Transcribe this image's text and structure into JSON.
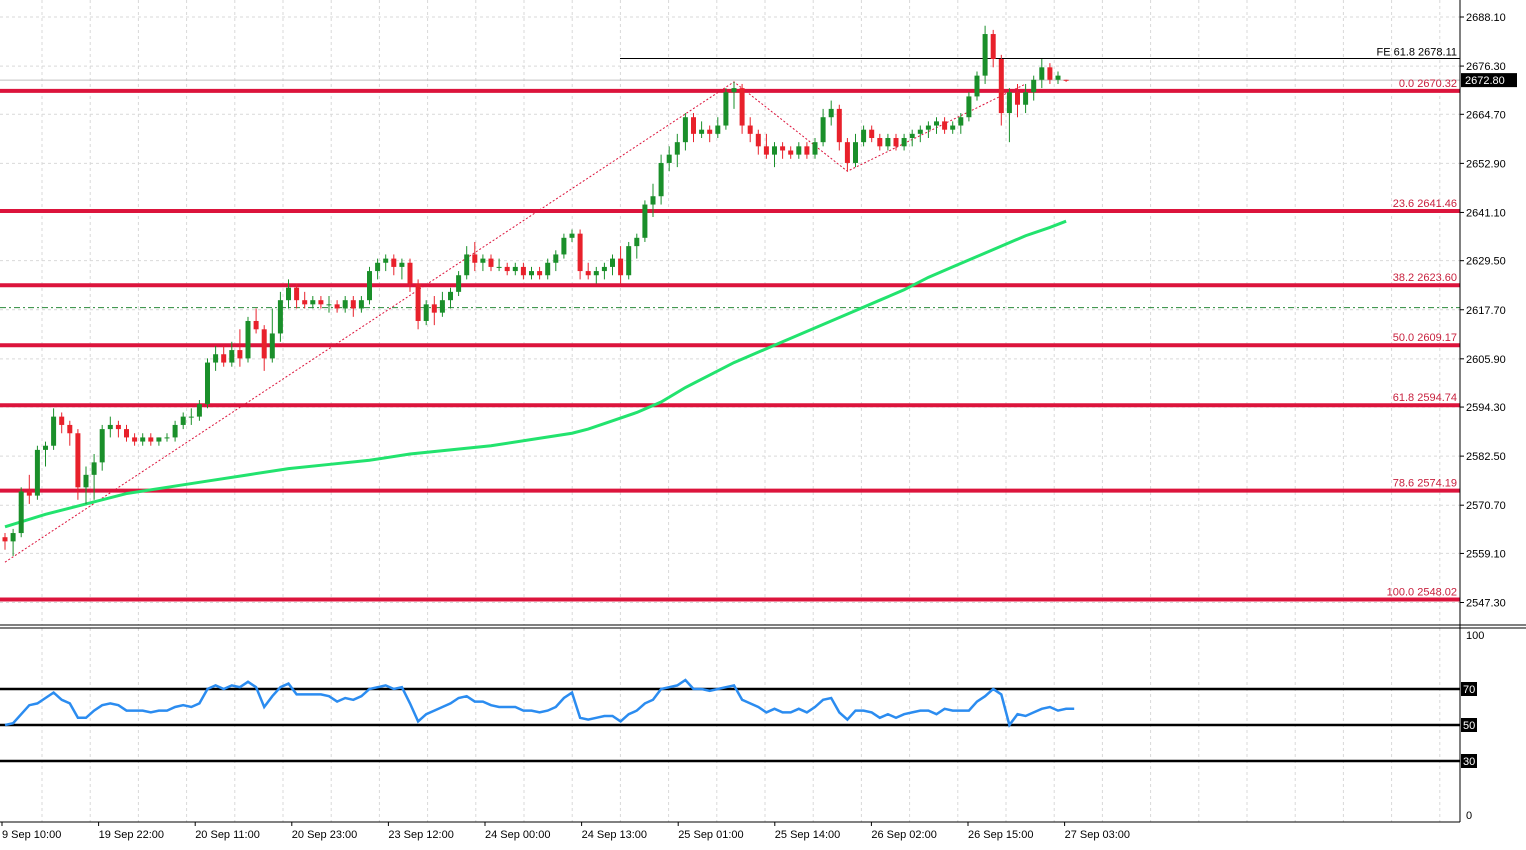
{
  "chart_data": {
    "type": "candlestick",
    "instrument_note": "",
    "colors": {
      "background": "#ffffff",
      "grid": "#d9d9d9",
      "bull": "#1a8f2a",
      "bear": "#e8212b",
      "fib_line": "#dc143c",
      "fib_label": "#c8213e",
      "moving_average": "#22e36e",
      "zigzag": "#dc143c",
      "rsi_line": "#2b8cf0",
      "rsi_levels": "#000000",
      "axis_text": "#000000",
      "price_label_bg": "#000000",
      "price_label_fg": "#ffffff"
    },
    "price_axis": {
      "range": [
        2543.0,
        2693.0
      ],
      "ticks": [
        "2688.10",
        "2676.30",
        "2664.70",
        "2652.90",
        "2641.10",
        "2629.50",
        "2617.70",
        "2605.90",
        "2594.30",
        "2582.50",
        "2570.70",
        "2559.10",
        "2547.30"
      ]
    },
    "current_price": {
      "value": 2672.8,
      "label": "2672.80"
    },
    "x_axis_labels": [
      "9 Sep 10:00",
      "19 Sep 22:00",
      "20 Sep 11:00",
      "20 Sep 23:00",
      "23 Sep 12:00",
      "24 Sep 00:00",
      "24 Sep 13:00",
      "25 Sep 01:00",
      "25 Sep 14:00",
      "26 Sep 02:00",
      "26 Sep 15:00",
      "27 Sep 03:00"
    ],
    "fib_levels": [
      {
        "level": 0.0,
        "price": 2670.32,
        "label": "0.0 2670.32"
      },
      {
        "level": 23.6,
        "price": 2641.46,
        "label": "23.6 2641.46"
      },
      {
        "level": 38.2,
        "price": 2623.6,
        "label": "38.2 2623.60"
      },
      {
        "level": 50.0,
        "price": 2609.17,
        "label": "50.0 2609.17"
      },
      {
        "level": 61.8,
        "price": 2594.74,
        "label": "61.8 2594.74"
      },
      {
        "level": 78.6,
        "price": 2574.19,
        "label": "78.6 2574.19"
      },
      {
        "level": 100.0,
        "price": 2548.02,
        "label": "100.0 2548.02"
      }
    ],
    "fib_extension": {
      "price": 2678.11,
      "label": "FE 61.8 2678.11"
    },
    "horizontal_dashed_price": 2618.2,
    "zigzag_points": [
      {
        "i": 0,
        "price": 2557.0
      },
      {
        "i": 90,
        "price": 2672.5
      },
      {
        "i": 104,
        "price": 2651.0
      },
      {
        "i": 126,
        "price": 2672.0
      }
    ],
    "candles": [
      [
        2563.0,
        2564.0,
        2560.0,
        2562.0
      ],
      [
        2562.0,
        2565.0,
        2558.5,
        2564.0
      ],
      [
        2564.0,
        2575.0,
        2563.0,
        2574.0
      ],
      [
        2574.0,
        2578.0,
        2571.0,
        2573.0
      ],
      [
        2573.0,
        2585.0,
        2572.0,
        2584.0
      ],
      [
        2584.0,
        2586.0,
        2580.0,
        2585.0
      ],
      [
        2585.0,
        2594.0,
        2584.0,
        2592.0
      ],
      [
        2592.0,
        2593.0,
        2588.0,
        2590.0
      ],
      [
        2590.0,
        2591.0,
        2585.0,
        2588.0
      ],
      [
        2588.0,
        2589.0,
        2572.0,
        2575.0
      ],
      [
        2575.0,
        2580.0,
        2571.0,
        2578.0
      ],
      [
        2578.0,
        2583.0,
        2572.0,
        2581.0
      ],
      [
        2581.0,
        2590.0,
        2579.0,
        2589.0
      ],
      [
        2589.0,
        2592.0,
        2587.0,
        2590.0
      ],
      [
        2590.0,
        2591.0,
        2587.0,
        2589.0
      ],
      [
        2589.0,
        2590.0,
        2586.0,
        2587.0
      ],
      [
        2587.0,
        2588.0,
        2585.0,
        2586.0
      ],
      [
        2586.0,
        2588.0,
        2585.0,
        2587.0
      ],
      [
        2587.0,
        2588.0,
        2585.0,
        2586.0
      ],
      [
        2586.0,
        2587.0,
        2585.0,
        2587.0
      ],
      [
        2587.0,
        2588.0,
        2586.0,
        2587.0
      ],
      [
        2587.0,
        2591.0,
        2586.0,
        2590.0
      ],
      [
        2590.0,
        2593.0,
        2589.0,
        2592.0
      ],
      [
        2592.0,
        2594.0,
        2590.0,
        2592.0
      ],
      [
        2592.0,
        2596.0,
        2591.0,
        2595.0
      ],
      [
        2595.0,
        2606.0,
        2594.0,
        2605.0
      ],
      [
        2605.0,
        2609.0,
        2603.0,
        2607.0
      ],
      [
        2607.0,
        2609.0,
        2604.0,
        2605.0
      ],
      [
        2605.0,
        2610.0,
        2604.0,
        2608.0
      ],
      [
        2608.0,
        2613.0,
        2604.0,
        2606.0
      ],
      [
        2606.0,
        2616.0,
        2605.0,
        2615.0
      ],
      [
        2615.0,
        2618.0,
        2612.0,
        2613.0
      ],
      [
        2613.0,
        2614.0,
        2603.0,
        2606.0
      ],
      [
        2606.0,
        2618.0,
        2605.0,
        2612.0
      ],
      [
        2612.0,
        2622.0,
        2610.0,
        2620.0
      ],
      [
        2620.0,
        2625.0,
        2618.0,
        2623.0
      ],
      [
        2623.0,
        2624.0,
        2618.0,
        2620.0
      ],
      [
        2620.0,
        2622.0,
        2618.0,
        2619.0
      ],
      [
        2619.0,
        2621.0,
        2618.0,
        2620.0
      ],
      [
        2620.0,
        2621.0,
        2618.0,
        2619.0
      ],
      [
        2619.0,
        2621.0,
        2617.0,
        2619.0
      ],
      [
        2619.0,
        2620.0,
        2617.0,
        2618.0
      ],
      [
        2618.0,
        2621.0,
        2617.0,
        2620.0
      ],
      [
        2620.0,
        2621.0,
        2616.0,
        2618.0
      ],
      [
        2618.0,
        2621.0,
        2617.0,
        2620.0
      ],
      [
        2620.0,
        2628.0,
        2619.0,
        2627.0
      ],
      [
        2627.0,
        2630.0,
        2625.0,
        2629.0
      ],
      [
        2629.0,
        2631.0,
        2627.0,
        2630.0
      ],
      [
        2630.0,
        2631.0,
        2626.0,
        2628.0
      ],
      [
        2628.0,
        2630.0,
        2625.0,
        2629.0
      ],
      [
        2629.0,
        2630.0,
        2622.0,
        2624.0
      ],
      [
        2624.0,
        2625.0,
        2613.0,
        2615.0
      ],
      [
        2615.0,
        2620.0,
        2614.0,
        2619.0
      ],
      [
        2619.0,
        2621.0,
        2614.0,
        2617.0
      ],
      [
        2617.0,
        2622.0,
        2616.0,
        2620.0
      ],
      [
        2620.0,
        2623.0,
        2618.0,
        2622.0
      ],
      [
        2622.0,
        2627.0,
        2621.0,
        2626.0
      ],
      [
        2626.0,
        2633.0,
        2625.0,
        2631.0
      ],
      [
        2631.0,
        2634.0,
        2627.0,
        2629.0
      ],
      [
        2629.0,
        2631.0,
        2627.0,
        2630.0
      ],
      [
        2630.0,
        2631.0,
        2627.0,
        2628.0
      ],
      [
        2628.0,
        2630.0,
        2627.0,
        2628.0
      ],
      [
        2628.0,
        2629.0,
        2626.0,
        2627.0
      ],
      [
        2627.0,
        2629.0,
        2626.0,
        2628.0
      ],
      [
        2628.0,
        2629.0,
        2625.0,
        2626.0
      ],
      [
        2626.0,
        2628.0,
        2625.0,
        2627.0
      ],
      [
        2627.0,
        2628.0,
        2625.0,
        2626.0
      ],
      [
        2626.0,
        2630.0,
        2625.0,
        2629.0
      ],
      [
        2629.0,
        2632.0,
        2627.0,
        2631.0
      ],
      [
        2631.0,
        2636.0,
        2630.0,
        2635.0
      ],
      [
        2635.0,
        2637.0,
        2634.0,
        2636.0
      ],
      [
        2636.0,
        2637.0,
        2625.0,
        2627.0
      ],
      [
        2627.0,
        2629.0,
        2625.0,
        2626.0
      ],
      [
        2626.0,
        2628.0,
        2624.0,
        2627.0
      ],
      [
        2627.0,
        2629.0,
        2625.0,
        2628.0
      ],
      [
        2628.0,
        2631.0,
        2626.0,
        2630.0
      ],
      [
        2630.0,
        2633.0,
        2624.0,
        2626.0
      ],
      [
        2626.0,
        2634.0,
        2625.0,
        2633.0
      ],
      [
        2633.0,
        2636.0,
        2630.0,
        2635.0
      ],
      [
        2635.0,
        2644.0,
        2634.0,
        2643.0
      ],
      [
        2643.0,
        2648.0,
        2640.0,
        2645.0
      ],
      [
        2645.0,
        2655.0,
        2643.0,
        2653.0
      ],
      [
        2653.0,
        2657.0,
        2651.0,
        2655.0
      ],
      [
        2655.0,
        2660.0,
        2652.0,
        2658.0
      ],
      [
        2658.0,
        2665.0,
        2656.0,
        2664.0
      ],
      [
        2664.0,
        2665.0,
        2658.0,
        2660.0
      ],
      [
        2660.0,
        2663.0,
        2659.0,
        2661.0
      ],
      [
        2661.0,
        2662.0,
        2658.0,
        2660.0
      ],
      [
        2660.0,
        2664.0,
        2659.0,
        2662.0
      ],
      [
        2662.0,
        2671.0,
        2661.0,
        2670.0
      ],
      [
        2670.0,
        2672.5,
        2666.0,
        2671.0
      ],
      [
        2671.0,
        2672.0,
        2660.0,
        2662.0
      ],
      [
        2662.0,
        2664.0,
        2658.0,
        2660.0
      ],
      [
        2660.0,
        2661.0,
        2655.0,
        2657.0
      ],
      [
        2657.0,
        2660.0,
        2654.0,
        2655.0
      ],
      [
        2655.0,
        2658.0,
        2652.0,
        2657.0
      ],
      [
        2657.0,
        2658.0,
        2654.0,
        2656.0
      ],
      [
        2656.0,
        2657.0,
        2654.0,
        2655.0
      ],
      [
        2655.0,
        2658.0,
        2654.0,
        2657.0
      ],
      [
        2657.0,
        2658.0,
        2654.0,
        2655.0
      ],
      [
        2655.0,
        2659.0,
        2654.0,
        2658.0
      ],
      [
        2658.0,
        2666.0,
        2657.0,
        2664.0
      ],
      [
        2664.0,
        2668.0,
        2662.0,
        2666.0
      ],
      [
        2666.0,
        2667.0,
        2656.0,
        2658.0
      ],
      [
        2658.0,
        2659.0,
        2651.0,
        2653.0
      ],
      [
        2653.0,
        2660.0,
        2652.0,
        2658.0
      ],
      [
        2658.0,
        2662.0,
        2657.0,
        2661.0
      ],
      [
        2661.0,
        2662.0,
        2658.0,
        2659.0
      ],
      [
        2659.0,
        2660.0,
        2656.0,
        2657.0
      ],
      [
        2657.0,
        2660.0,
        2656.0,
        2659.0
      ],
      [
        2659.0,
        2660.0,
        2656.0,
        2657.0
      ],
      [
        2657.0,
        2660.0,
        2656.0,
        2659.0
      ],
      [
        2659.0,
        2661.0,
        2657.0,
        2660.0
      ],
      [
        2660.0,
        2662.0,
        2658.0,
        2661.0
      ],
      [
        2661.0,
        2663.0,
        2659.0,
        2662.0
      ],
      [
        2662.0,
        2664.0,
        2660.0,
        2663.0
      ],
      [
        2663.0,
        2664.0,
        2660.0,
        2661.0
      ],
      [
        2661.0,
        2663.0,
        2660.0,
        2662.0
      ],
      [
        2662.0,
        2665.0,
        2660.0,
        2664.0
      ],
      [
        2664.0,
        2670.0,
        2663.0,
        2669.0
      ],
      [
        2669.0,
        2675.0,
        2668.0,
        2674.0
      ],
      [
        2674.0,
        2686.0,
        2672.0,
        2684.0
      ],
      [
        2684.0,
        2685.0,
        2676.0,
        2678.0
      ],
      [
        2678.0,
        2679.0,
        2662.0,
        2665.0
      ],
      [
        2665.0,
        2671.0,
        2658.0,
        2670.0
      ],
      [
        2670.0,
        2672.0,
        2664.0,
        2667.0
      ],
      [
        2667.0,
        2672.0,
        2665.0,
        2670.0
      ],
      [
        2670.0,
        2674.0,
        2668.0,
        2673.0
      ],
      [
        2673.0,
        2678.0,
        2671.0,
        2676.0
      ],
      [
        2676.0,
        2677.0,
        2672.0,
        2673.0
      ],
      [
        2673.0,
        2675.0,
        2672.0,
        2674.0
      ],
      [
        2673.0,
        2673.0,
        2672.5,
        2672.8
      ]
    ],
    "moving_average": [
      [
        0,
        2565.5
      ],
      [
        5,
        2568.5
      ],
      [
        10,
        2571.0
      ],
      [
        15,
        2573.5
      ],
      [
        20,
        2575.0
      ],
      [
        25,
        2576.5
      ],
      [
        30,
        2578.0
      ],
      [
        35,
        2579.5
      ],
      [
        40,
        2580.5
      ],
      [
        45,
        2581.5
      ],
      [
        50,
        2583.0
      ],
      [
        55,
        2584.0
      ],
      [
        60,
        2585.0
      ],
      [
        65,
        2586.5
      ],
      [
        70,
        2588.0
      ],
      [
        72,
        2589.0
      ],
      [
        75,
        2591.0
      ],
      [
        78,
        2593.0
      ],
      [
        81,
        2595.5
      ],
      [
        84,
        2599.0
      ],
      [
        87,
        2602.0
      ],
      [
        90,
        2605.0
      ],
      [
        93,
        2607.5
      ],
      [
        96,
        2610.0
      ],
      [
        99,
        2612.5
      ],
      [
        102,
        2615.0
      ],
      [
        105,
        2617.5
      ],
      [
        108,
        2620.0
      ],
      [
        111,
        2622.5
      ],
      [
        114,
        2625.5
      ],
      [
        117,
        2628.0
      ],
      [
        120,
        2630.5
      ],
      [
        123,
        2633.0
      ],
      [
        126,
        2635.5
      ],
      [
        129,
        2637.5
      ],
      [
        131,
        2639.0
      ]
    ],
    "rsi": {
      "axis_labels": [
        "100",
        "0"
      ],
      "levels": [
        {
          "value": 70,
          "label": "70"
        },
        {
          "value": 50,
          "label": "50"
        },
        {
          "value": 30,
          "label": "30"
        }
      ],
      "range": [
        0,
        100
      ],
      "values": [
        50.0,
        51.0,
        56.0,
        61.0,
        62.0,
        65.0,
        68.0,
        64.0,
        62.0,
        54.0,
        54.0,
        58.0,
        61.0,
        62.0,
        61.0,
        58.0,
        58.0,
        58.0,
        57.0,
        58.0,
        58.0,
        60.0,
        61.0,
        60.0,
        62.0,
        70.0,
        72.0,
        70.0,
        72.0,
        71.0,
        74.0,
        71.0,
        60.0,
        66.0,
        71.0,
        73.0,
        67.0,
        67.0,
        67.0,
        67.0,
        66.0,
        63.0,
        65.0,
        64.0,
        66.0,
        70.0,
        71.0,
        72.0,
        70.0,
        71.0,
        62.0,
        52.0,
        56.0,
        58.0,
        60.0,
        62.0,
        65.0,
        66.0,
        63.0,
        63.0,
        61.0,
        60.0,
        60.0,
        60.0,
        58.0,
        58.0,
        57.0,
        58.0,
        60.0,
        65.0,
        68.0,
        54.0,
        53.0,
        54.0,
        55.0,
        55.0,
        52.0,
        56.0,
        58.0,
        62.0,
        64.0,
        70.0,
        71.0,
        72.0,
        75.0,
        70.0,
        70.0,
        69.0,
        70.0,
        71.0,
        72.0,
        64.0,
        62.0,
        60.0,
        57.0,
        59.0,
        57.0,
        57.0,
        59.0,
        57.0,
        60.0,
        64.0,
        65.0,
        57.0,
        53.0,
        58.0,
        58.0,
        57.0,
        54.0,
        56.0,
        54.0,
        56.0,
        57.0,
        58.0,
        58.0,
        56.0,
        59.0,
        58.0,
        58.0,
        58.0,
        63.0,
        66.0,
        70.0,
        67.0,
        50.0,
        56.0,
        55.0,
        57.0,
        59.0,
        60.0,
        58.0,
        59.0,
        59.0
      ]
    }
  }
}
